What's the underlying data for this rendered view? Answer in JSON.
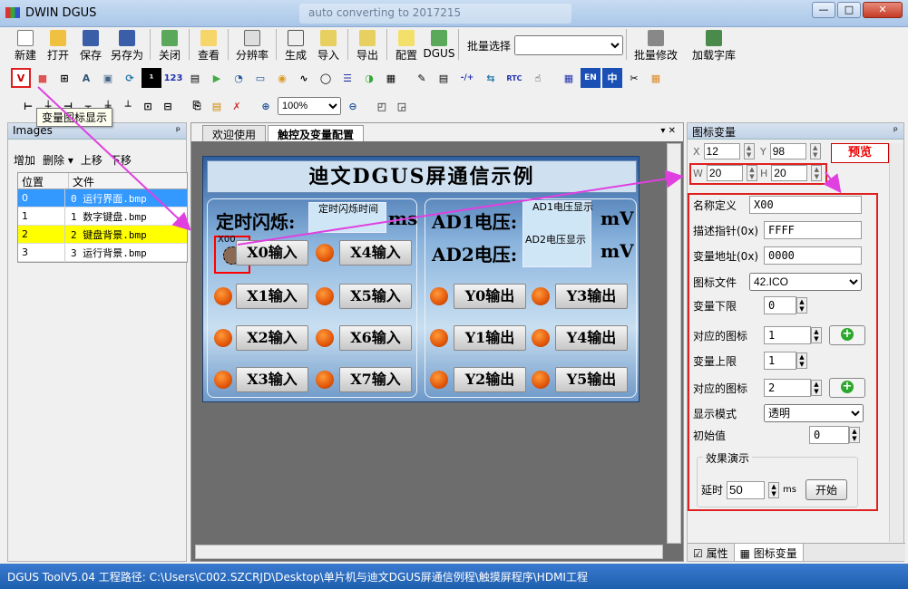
{
  "window": {
    "title": "DWIN DGUS",
    "watermark": "auto converting to 2017215",
    "minimize": "—",
    "restore": "□",
    "close": "✕"
  },
  "toolbar": {
    "new": "新建",
    "open": "打开",
    "save": "保存",
    "saveas": "另存为",
    "close": "关闭",
    "view": "查看",
    "resolution": "分辨率",
    "generate": "生成",
    "import": "导入",
    "export": "导出",
    "config": "配置",
    "dgus": "DGUS",
    "batch_select_label": "批量选择",
    "batch_select_value": "",
    "batch_modify": "批量修改",
    "load_font": "加载字库"
  },
  "toolbar2": [
    "V",
    "■",
    "⊞",
    "A",
    "▣",
    "⟳",
    "¹",
    "123",
    "▤",
    "▶",
    "◔",
    "▭",
    "◉",
    "∿",
    "◯",
    "☰",
    "◑",
    "▦",
    "✎",
    "▤",
    "-/+",
    "⇆",
    "RTC",
    "☝",
    "▦",
    "EN",
    "中",
    "✂",
    "▦"
  ],
  "toolbar3": {
    "zoom": "100%"
  },
  "tooltip": "变量图标显示",
  "images_panel": {
    "title": "Images",
    "pin": "ᵖ",
    "add": "增加",
    "delete": "删除 ▾",
    "up": "上移",
    "down": "下移",
    "col_pos": "位置",
    "col_file": "文件",
    "rows": [
      {
        "pos": "0",
        "file": "0 运行界面.bmp"
      },
      {
        "pos": "1",
        "file": "1 数字键盘.bmp"
      },
      {
        "pos": "2",
        "file": "2 键盘背景.bmp"
      },
      {
        "pos": "3",
        "file": "3 运行背景.bmp"
      }
    ]
  },
  "tabs": {
    "welcome": "欢迎使用",
    "touch_config": "触控及变量配置",
    "ctl": "▾ ✕"
  },
  "canvas": {
    "banner": "迪文DGUS屏通信示例",
    "timer_label": "定时闪烁:",
    "timer_box": "定时闪烁时间",
    "ms": "ms",
    "ad1": "AD1电压:",
    "ad2": "AD2电压:",
    "ad1_box": "AD1电压显示",
    "ad2_box": "AD2电压显示",
    "mv1": "mV",
    "mv2": "mV",
    "x00": "X00",
    "inputs": [
      "X0输入",
      "X1输入",
      "X2输入",
      "X3输入",
      "X4输入",
      "X5输入",
      "X6输入",
      "X7输入"
    ],
    "outputs": [
      "Y0输出",
      "Y1输出",
      "Y2输出",
      "Y3输出",
      "Y4输出",
      "Y5输出"
    ]
  },
  "icon_var": {
    "title": "图标变量",
    "pin": "ᵖ",
    "x_label": "X",
    "x": "12",
    "y_label": "Y",
    "y": "98",
    "w_label": "W",
    "w": "20",
    "h_label": "H",
    "h": "20",
    "preview": "预览",
    "name_label": "名称定义",
    "name": "X00",
    "desc_label": "描述指针(0x)",
    "desc": "FFFF",
    "addr_label": "变量地址(0x)",
    "addr": "0000",
    "icon_file_label": "图标文件",
    "icon_file": "42.ICO",
    "low_label": "变量下限",
    "low": "0",
    "icon1_label": "对应的图标",
    "icon1": "1",
    "high_label": "变量上限",
    "high": "1",
    "icon2_label": "对应的图标",
    "icon2": "2",
    "mode_label": "显示模式",
    "mode": "透明",
    "init_label": "初始值",
    "init": "0",
    "fx_legend": "效果演示",
    "delay_label": "延时",
    "delay": "50",
    "delay_unit": "ms",
    "start": "开始",
    "tab_attr": "属性",
    "tab_icon": "图标变量"
  },
  "status": "DGUS ToolV5.04  工程路径: C:\\Users\\C002.SZCRJD\\Desktop\\单片机与迪文DGUS屏通信例程\\触摸屏程序\\HDMI工程"
}
